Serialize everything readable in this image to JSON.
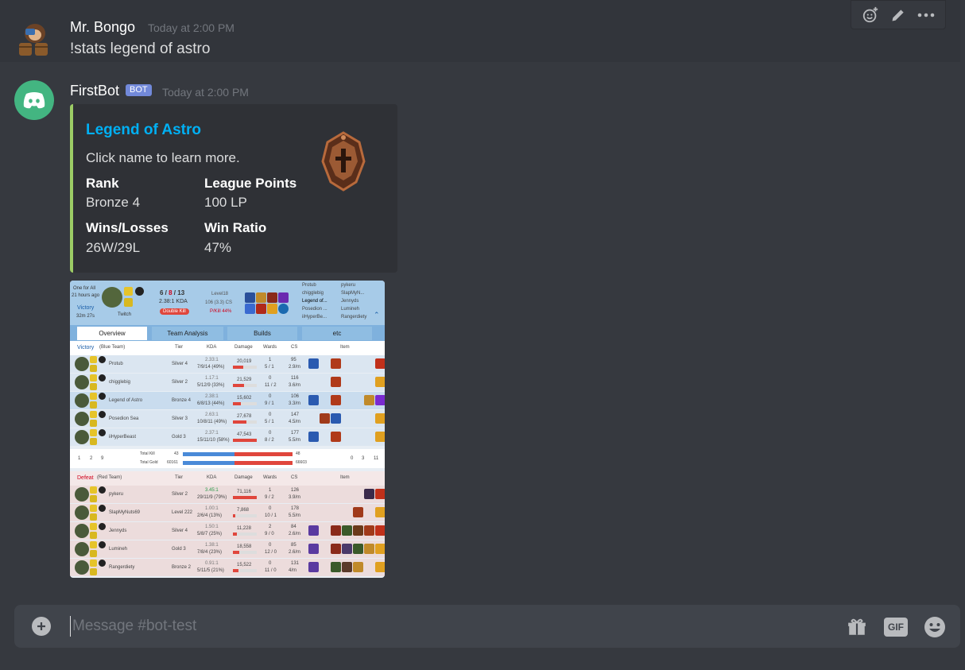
{
  "messages": [
    {
      "author": "Mr. Bongo",
      "timestamp": "Today at 2:00 PM",
      "content": "!stats legend of astro"
    },
    {
      "author": "FirstBot",
      "bot_tag": "BOT",
      "timestamp": "Today at 2:00 PM",
      "embed": {
        "accent_color": "#9ccc65",
        "title": "Legend of Astro",
        "description": "Click name to learn more.",
        "fields": [
          {
            "name": "Rank",
            "value": "Bronze 4"
          },
          {
            "name": "League Points",
            "value": "100 LP"
          },
          {
            "name": "Wins/Losses",
            "value": "26W/29L"
          },
          {
            "name": "Win Ratio",
            "value": "47%"
          }
        ],
        "thumbnail_icon": "bronze-rank-emblem-icon"
      },
      "attachment": {
        "header": {
          "queue": "One for All",
          "when": "21 hours ago",
          "result": "Victory",
          "duration": "32m 27s",
          "champion": "Twitch",
          "kda_k": "6",
          "kda_d": "8",
          "kda_a": "13",
          "kda_ratio": "2.38:1 KDA",
          "multikill": "Double Kill",
          "level": "Level18",
          "cs": "106 (3.3) CS",
          "pkill": "P/Kill 44%",
          "team_left": [
            "Protub",
            "chigglebig",
            "Legend of...",
            "Posedion ...",
            "iiHyperBe..."
          ],
          "team_right": [
            "pykeru",
            "SlapMyN...",
            "Jennyds",
            "Lumineh",
            "Rangerdiety"
          ]
        },
        "tabs": [
          "Overview",
          "Team Analysis",
          "Builds",
          "etc"
        ],
        "columns": [
          "Tier",
          "KDA",
          "Damage",
          "Wards",
          "CS",
          "Item"
        ],
        "blue_team": {
          "result": "Victory",
          "label": "(Blue Team)",
          "players": [
            {
              "name": "Protub",
              "tier": "Silver 4",
              "kda": "2.33:1",
              "kda_detail": "7/9/14 (49%)",
              "damage": "20,019",
              "damage_frac": 0.42,
              "wards": "1",
              "wards_detail": "5 / 1",
              "cs": "95",
              "cs_detail": "2.9/m"
            },
            {
              "name": "chigglebig",
              "tier": "Silver 2",
              "kda": "1.17:1",
              "kda_detail": "5/12/9 (33%)",
              "damage": "21,529",
              "damage_frac": 0.45,
              "wards": "0",
              "wards_detail": "11 / 2",
              "cs": "116",
              "cs_detail": "3.6/m"
            },
            {
              "name": "Legend of Astro",
              "tier": "Bronze 4",
              "kda": "2.38:1",
              "kda_detail": "6/8/13 (44%)",
              "damage": "15,602",
              "damage_frac": 0.33,
              "wards": "0",
              "wards_detail": "9 / 1",
              "cs": "106",
              "cs_detail": "3.3/m"
            },
            {
              "name": "Posedion Sea",
              "tier": "Silver 3",
              "kda": "2.63:1",
              "kda_detail": "10/8/11 (49%)",
              "damage": "27,678",
              "damage_frac": 0.58,
              "wards": "0",
              "wards_detail": "5 / 1",
              "cs": "147",
              "cs_detail": "4.5/m"
            },
            {
              "name": "iiHyperBeast",
              "tier": "Gold 3",
              "kda": "2.37:1",
              "kda_detail": "15/11/10 (58%)",
              "damage": "47,543",
              "damage_frac": 1.0,
              "wards": "0",
              "wards_detail": "8 / 2",
              "cs": "177",
              "cs_detail": "5.5/m"
            }
          ]
        },
        "totals": {
          "left_nums": [
            "1",
            "2",
            "9"
          ],
          "right_nums": [
            "0",
            "3",
            "11"
          ],
          "kill_label": "Total Kill",
          "kill_blue": "43",
          "kill_red": "48",
          "gold_label": "Total Gold",
          "gold_blue": "60161",
          "gold_red": "66603",
          "kill_blue_frac": 0.47,
          "gold_blue_frac": 0.47
        },
        "red_team": {
          "result": "Defeat",
          "label": "(Red Team)",
          "players": [
            {
              "name": "pykeru",
              "tier": "Silver 2",
              "kda": "3.45:1",
              "kda_detail": "29/11/9 (79%)",
              "damage": "71,116",
              "damage_frac": 1.0,
              "wards": "1",
              "wards_detail": "9 / 2",
              "cs": "126",
              "cs_detail": "3.9/m"
            },
            {
              "name": "SlapMyNuts69",
              "tier": "Level 222",
              "kda": "1.00:1",
              "kda_detail": "2/6/4 (13%)",
              "damage": "7,868",
              "damage_frac": 0.11,
              "wards": "0",
              "wards_detail": "10 / 1",
              "cs": "178",
              "cs_detail": "5.5/m"
            },
            {
              "name": "Jennyds",
              "tier": "Silver 4",
              "kda": "1.50:1",
              "kda_detail": "5/8/7 (25%)",
              "damage": "11,228",
              "damage_frac": 0.16,
              "wards": "2",
              "wards_detail": "9 / 0",
              "cs": "84",
              "cs_detail": "2.6/m"
            },
            {
              "name": "Lumineh",
              "tier": "Gold 3",
              "kda": "1.38:1",
              "kda_detail": "7/8/4 (23%)",
              "damage": "18,558",
              "damage_frac": 0.26,
              "wards": "0",
              "wards_detail": "12 / 0",
              "cs": "85",
              "cs_detail": "2.6/m"
            },
            {
              "name": "Rangerdiety",
              "tier": "Bronze 2",
              "kda": "0.91:1",
              "kda_detail": "5/11/5 (21%)",
              "damage": "15,522",
              "damage_frac": 0.22,
              "wards": "0",
              "wards_detail": "11 / 0",
              "cs": "131",
              "cs_detail": "4/m"
            }
          ]
        }
      }
    }
  ],
  "input": {
    "placeholder": "Message #bot-test"
  },
  "input_bar": {
    "gif_label": "GIF"
  },
  "colors": {
    "background": "#36393f",
    "embed_link": "#00b0f4",
    "bot_tag": "#7289da",
    "bot_avatar": "#43b581"
  }
}
